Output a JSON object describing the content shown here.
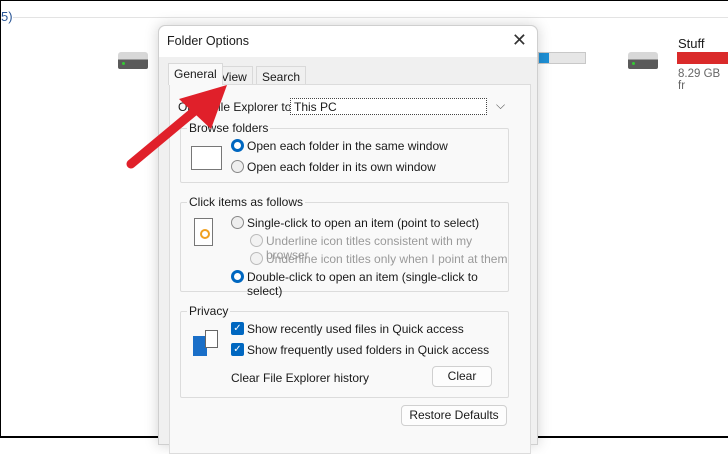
{
  "background": {
    "crumb": "5)",
    "drive_right": {
      "name": "Stuff",
      "free": "8.29 GB fr"
    },
    "colors": {
      "bar_blue": "#1e90d6",
      "bar_red": "#da2a2a"
    }
  },
  "dialog": {
    "title": "Folder Options",
    "tabs": [
      "General",
      "View",
      "Search"
    ],
    "open_label": "Open File Explorer to:",
    "open_value": "This PC",
    "browse": {
      "legend": "Browse folders",
      "options": [
        "Open each folder in the same window",
        "Open each folder in its own window"
      ]
    },
    "click": {
      "legend": "Click items as follows",
      "single": "Single-click to open an item (point to select)",
      "sub1": "Underline icon titles consistent with my browser",
      "sub2": "Underline icon titles only when I point at them",
      "double": "Double-click to open an item (single-click to select)"
    },
    "privacy": {
      "legend": "Privacy",
      "recent": "Show recently used files in Quick access",
      "frequent": "Show frequently used folders in Quick access",
      "clear_label": "Clear File Explorer history",
      "clear_button": "Clear"
    },
    "restore": "Restore Defaults"
  }
}
